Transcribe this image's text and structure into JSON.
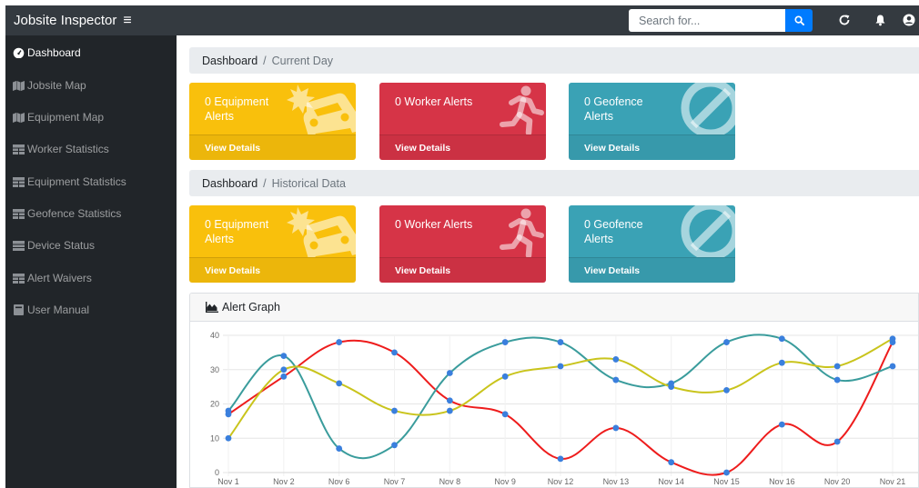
{
  "app": {
    "brand": "Jobsite Inspector",
    "search_placeholder": "Search for..."
  },
  "sidebar": {
    "items": [
      {
        "label": "Dashboard",
        "icon": "tachometer-icon",
        "active": true
      },
      {
        "label": "Jobsite Map",
        "icon": "map-icon",
        "active": false
      },
      {
        "label": "Equipment Map",
        "icon": "map-icon",
        "active": false
      },
      {
        "label": "Worker Statistics",
        "icon": "table-icon",
        "active": false
      },
      {
        "label": "Equipment Statistics",
        "icon": "table-icon",
        "active": false
      },
      {
        "label": "Geofence Statistics",
        "icon": "table-icon",
        "active": false
      },
      {
        "label": "Device Status",
        "icon": "table-icon",
        "active": false
      },
      {
        "label": "Alert Waivers",
        "icon": "table-icon",
        "active": false
      },
      {
        "label": "User Manual",
        "icon": "book-icon",
        "active": false
      }
    ]
  },
  "sections": [
    {
      "breadcrumb": {
        "root": "Dashboard",
        "current": "Current Day"
      },
      "cards": [
        {
          "title": "0 Equipment Alerts",
          "footer": "View Details",
          "color": "#f9c00c",
          "icon": "car-crash-icon"
        },
        {
          "title": "0 Worker Alerts",
          "footer": "View Details",
          "color": "#d63447",
          "icon": "running-person-icon"
        },
        {
          "title": "0 Geofence Alerts",
          "footer": "View Details",
          "color": "#3aa2b5",
          "icon": "ban-icon"
        }
      ]
    },
    {
      "breadcrumb": {
        "root": "Dashboard",
        "current": "Historical Data"
      },
      "cards": [
        {
          "title": "0 Equipment Alerts",
          "footer": "View Details",
          "color": "#f9c00c",
          "icon": "car-crash-icon"
        },
        {
          "title": "0 Worker Alerts",
          "footer": "View Details",
          "color": "#d63447",
          "icon": "running-person-icon"
        },
        {
          "title": "0 Geofence Alerts",
          "footer": "View Details",
          "color": "#3aa2b5",
          "icon": "ban-icon"
        }
      ]
    }
  ],
  "graph": {
    "title": "Alert Graph"
  },
  "chart_data": {
    "type": "line",
    "categories": [
      "Nov 1",
      "Nov 2",
      "Nov 6",
      "Nov 7",
      "Nov 8",
      "Nov 9",
      "Nov 12",
      "Nov 13",
      "Nov 14",
      "Nov 15",
      "Nov 16",
      "Nov 20",
      "Nov 21"
    ],
    "ylim": [
      0,
      40
    ],
    "yticks": [
      0,
      10,
      20,
      30,
      40
    ],
    "grid": true,
    "series": [
      {
        "color": "#ee1c1c",
        "values": [
          17,
          28,
          38,
          35,
          21,
          17,
          4,
          13,
          3,
          0,
          14,
          9,
          38
        ]
      },
      {
        "color": "#3a9c9c",
        "values": [
          18,
          34,
          7,
          8,
          29,
          38,
          38,
          27,
          26,
          38,
          39,
          27,
          31
        ]
      },
      {
        "color": "#c9c41c",
        "values": [
          10,
          30,
          26,
          18,
          18,
          28,
          31,
          33,
          25,
          24,
          32,
          31,
          39
        ]
      }
    ],
    "marker_color": "#3a7fdd"
  }
}
